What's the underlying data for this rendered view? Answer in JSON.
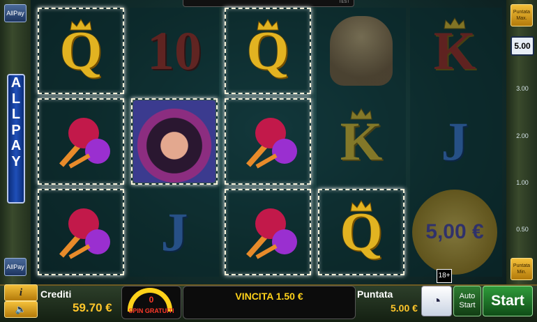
{
  "top_info": "TEST",
  "left": {
    "allpay_top": "AllPay",
    "allpay_bottom": "AllPay",
    "allpay_vertical": "ALLPAY"
  },
  "right": {
    "max_bet": "Puntata Max.",
    "min_bet": "Puntata Min.",
    "stake": "5.00",
    "scale": [
      "3.00",
      "2.00",
      "1.00",
      "0.50"
    ]
  },
  "reels": {
    "r1": [
      "Q",
      "maracas",
      "maracas"
    ],
    "r2": [
      "10",
      "woman",
      "J"
    ],
    "r3": [
      "Q",
      "maracas",
      "maracas"
    ],
    "r4": [
      "voodoo",
      "K",
      "Q"
    ],
    "r5": [
      "K",
      "J",
      "5,00 €"
    ]
  },
  "age_badge": "18+",
  "bottom": {
    "info_glyph": "i",
    "credits_label": "Crediti",
    "credits_value": "59.70 €",
    "free_spins_count": "0",
    "free_spins_label": "SPIN GRATUITI",
    "win_text": "VINCITA 1.50 €",
    "bet_label": "Puntata",
    "bet_value": "5.00 €",
    "auto_line1": "Auto",
    "auto_line2": "Start",
    "start_label": "Start"
  }
}
